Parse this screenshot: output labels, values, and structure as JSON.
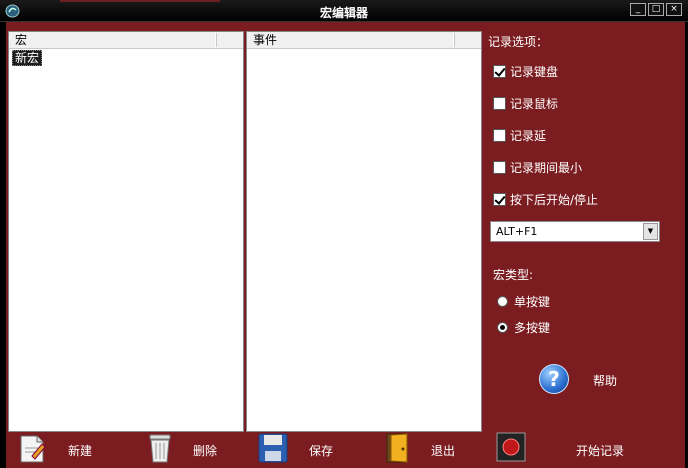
{
  "window": {
    "title": "宏编辑器",
    "controls": [
      "_",
      "□",
      "×"
    ]
  },
  "macro_list": {
    "header": "宏",
    "items": [
      "新宏"
    ]
  },
  "event_list": {
    "header": "事件",
    "items": []
  },
  "record_options": {
    "title": "记录选项：",
    "checkboxes": [
      {
        "label": "记录键盘",
        "checked": true
      },
      {
        "label": "记录鼠标",
        "checked": false
      },
      {
        "label": "记录延",
        "checked": false
      },
      {
        "label": "记录期间最小",
        "checked": false
      },
      {
        "label": "按下后开始/停止",
        "checked": true
      }
    ],
    "hotkey": "ALT+F1"
  },
  "macro_type": {
    "title": "宏类型:",
    "options": [
      {
        "label": "单按键",
        "selected": false
      },
      {
        "label": "多按键",
        "selected": true
      }
    ]
  },
  "help": {
    "label": "帮助",
    "icon": "help-icon"
  },
  "toolbar": {
    "new_label": "新建",
    "delete_label": "删除",
    "save_label": "保存",
    "exit_label": "退出",
    "record_label": "开始记录"
  },
  "colors": {
    "frame": "#7b1c20",
    "titlebar": "#000000"
  }
}
